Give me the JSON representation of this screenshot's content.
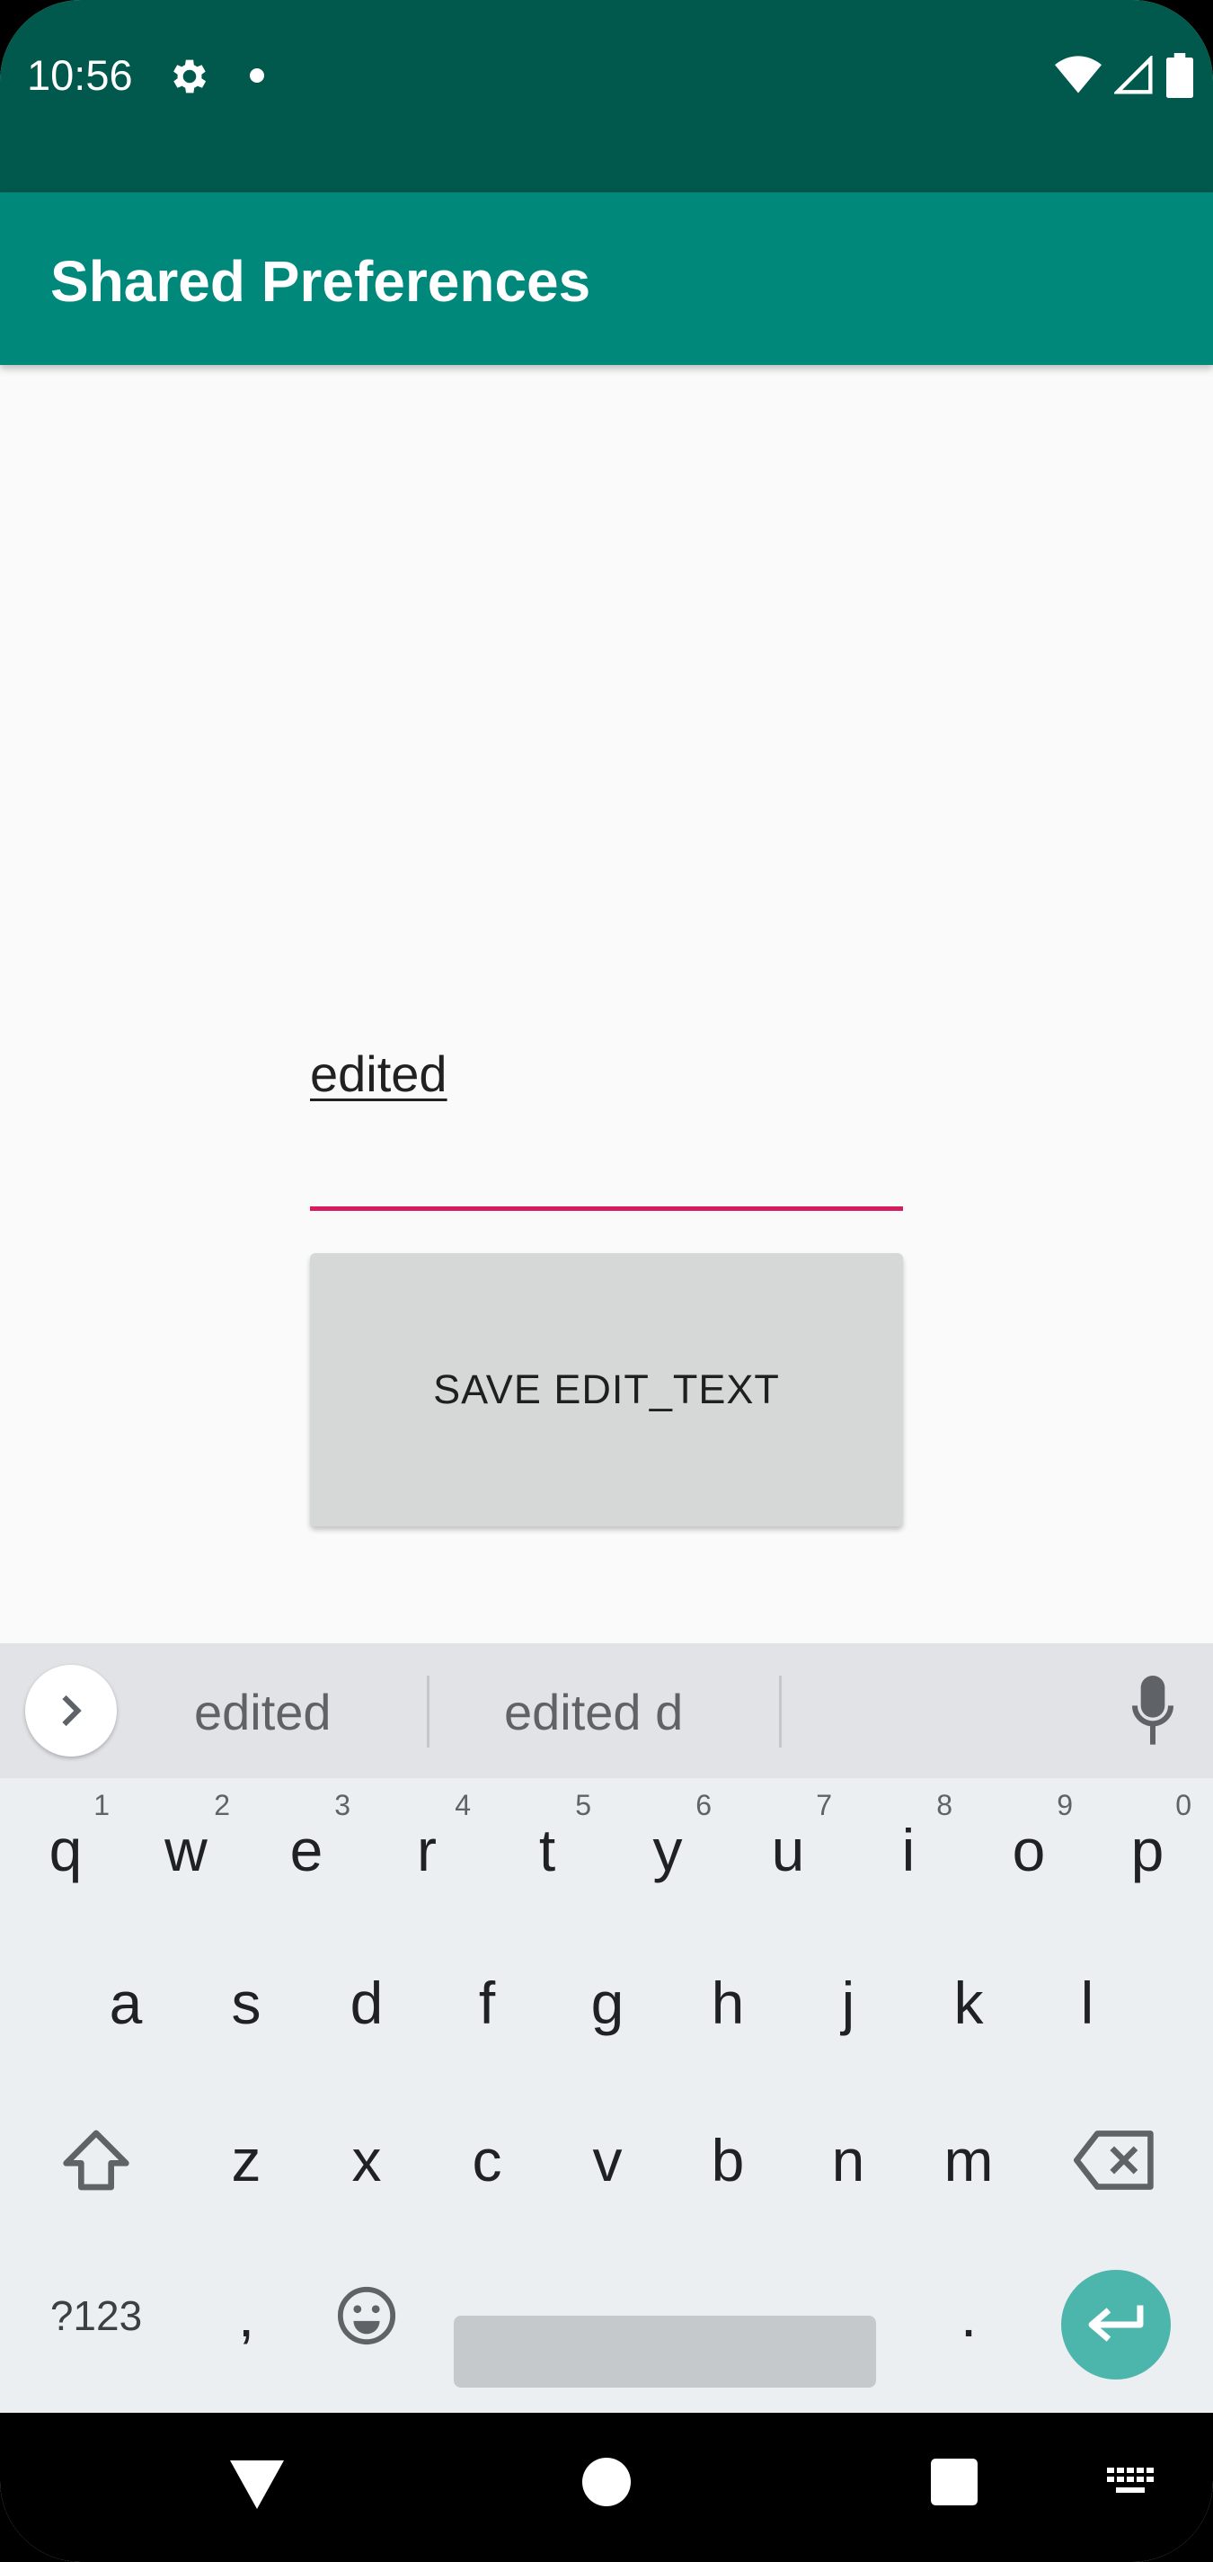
{
  "status_bar": {
    "time": "10:56",
    "icons": [
      "gear-icon",
      "dot-icon",
      "wifi-icon",
      "signal-icon",
      "battery-icon"
    ]
  },
  "app_bar": {
    "title": "Shared Preferences",
    "color": "#00897b"
  },
  "form": {
    "edit_text_value": "edited",
    "accent_color": "#d81b60",
    "save_button_label": "SAVE EDIT_TEXT"
  },
  "keyboard": {
    "suggestions": [
      "edited",
      "edited d"
    ],
    "row1": [
      {
        "k": "q",
        "h": "1"
      },
      {
        "k": "w",
        "h": "2"
      },
      {
        "k": "e",
        "h": "3"
      },
      {
        "k": "r",
        "h": "4"
      },
      {
        "k": "t",
        "h": "5"
      },
      {
        "k": "y",
        "h": "6"
      },
      {
        "k": "u",
        "h": "7"
      },
      {
        "k": "i",
        "h": "8"
      },
      {
        "k": "o",
        "h": "9"
      },
      {
        "k": "p",
        "h": "0"
      }
    ],
    "row2": [
      "a",
      "s",
      "d",
      "f",
      "g",
      "h",
      "j",
      "k",
      "l"
    ],
    "row3": [
      "z",
      "x",
      "c",
      "v",
      "b",
      "n",
      "m"
    ],
    "row4": {
      "symbols_label": "?123",
      "comma_label": ",",
      "period_label": "."
    },
    "enter_color": "#4db6ac"
  },
  "nav_bar": {
    "icons": [
      "back-icon",
      "home-icon",
      "recents-icon",
      "keyboard-switch-icon"
    ]
  }
}
